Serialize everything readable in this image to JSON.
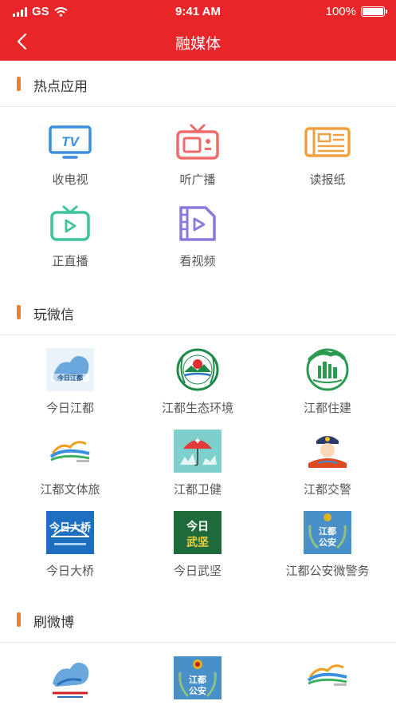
{
  "status_bar": {
    "carrier": "GS",
    "time": "9:41 AM",
    "battery": "100%"
  },
  "nav": {
    "title": "融媒体"
  },
  "sections": [
    {
      "title": "热点应用",
      "items": [
        {
          "label": "收电视",
          "icon": "tv-icon",
          "color": "#3a8fe0"
        },
        {
          "label": "听广播",
          "icon": "radio-icon",
          "color": "#f06a6a"
        },
        {
          "label": "读报纸",
          "icon": "newspaper-icon",
          "color": "#f0a040"
        },
        {
          "label": "正直播",
          "icon": "live-icon",
          "color": "#3cc49a"
        },
        {
          "label": "看视频",
          "icon": "video-icon",
          "color": "#8a78e0"
        }
      ]
    },
    {
      "title": "玩微信",
      "items": [
        {
          "label": "今日江都",
          "icon": "jinri-jiangdu-logo"
        },
        {
          "label": "江都生态环境",
          "icon": "ecology-environment-logo"
        },
        {
          "label": "江都住建",
          "icon": "housing-construction-logo"
        },
        {
          "label": "江都文体旅",
          "icon": "culture-sports-tourism-logo"
        },
        {
          "label": "江都卫健",
          "icon": "health-logo"
        },
        {
          "label": "江都交警",
          "icon": "traffic-police-logo"
        },
        {
          "label": "今日大桥",
          "icon": "jinri-daqiao-logo"
        },
        {
          "label": "今日武坚",
          "icon": "jinri-wujian-logo"
        },
        {
          "label": "江都公安微警务",
          "icon": "public-security-logo"
        }
      ]
    },
    {
      "title": "刷微博",
      "items": [
        {
          "label": "",
          "icon": "jiangdu-news-logo"
        },
        {
          "label": "",
          "icon": "public-security-badge-logo"
        },
        {
          "label": "",
          "icon": "culture-sports-tourism-logo"
        }
      ]
    }
  ]
}
